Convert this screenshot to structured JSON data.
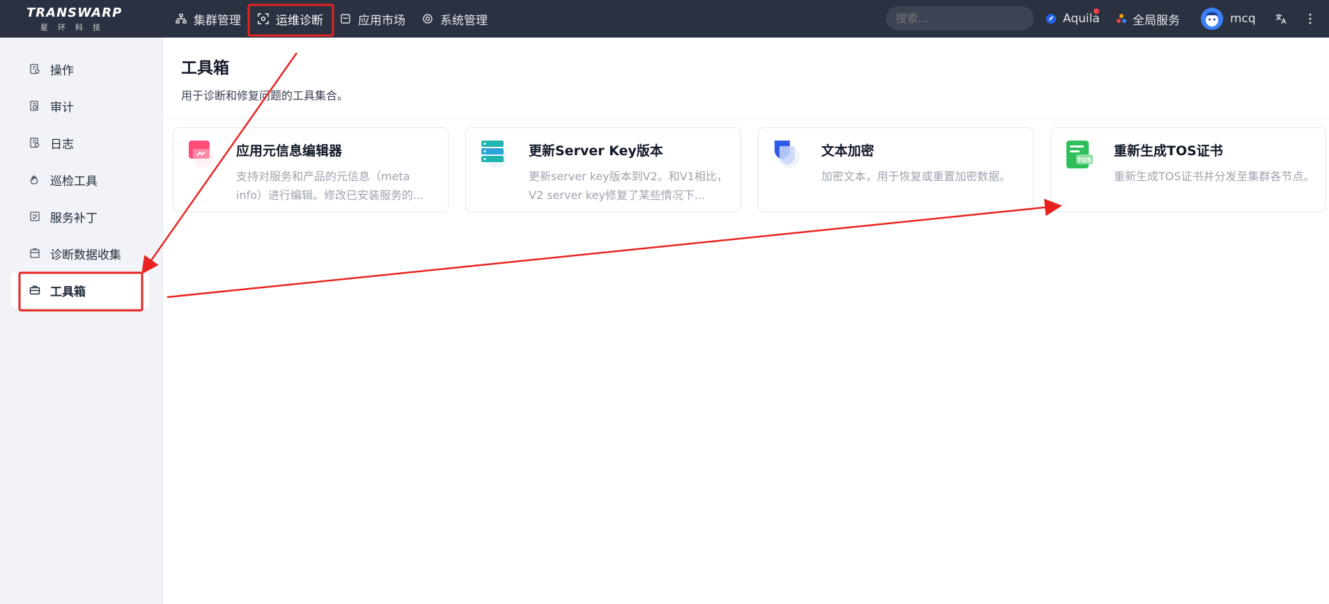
{
  "logo": {
    "main": "TRANSWARP",
    "sub": "星环科技"
  },
  "nav": [
    {
      "label": "集群管理",
      "icon": "cluster-icon"
    },
    {
      "label": "运维诊断",
      "icon": "scan-icon"
    },
    {
      "label": "应用市场",
      "icon": "store-icon"
    },
    {
      "label": "系统管理",
      "icon": "gear-icon"
    }
  ],
  "search": {
    "placeholder": "搜索..."
  },
  "top_right": {
    "aquila": "Aquila",
    "global_services": "全局服务",
    "user": "mcq"
  },
  "sidebar": {
    "items": [
      {
        "label": "操作",
        "icon": "operation-icon"
      },
      {
        "label": "审计",
        "icon": "audit-icon"
      },
      {
        "label": "日志",
        "icon": "log-icon"
      },
      {
        "label": "巡检工具",
        "icon": "patrol-icon"
      },
      {
        "label": "服务补丁",
        "icon": "patch-icon"
      },
      {
        "label": "诊断数据收集",
        "icon": "collect-icon"
      },
      {
        "label": "工具箱",
        "icon": "toolbox-icon"
      }
    ]
  },
  "main": {
    "title": "工具箱",
    "description": "用于诊断和修复问题的工具集合。",
    "cards": [
      {
        "title": "应用元信息编辑器",
        "description": "支持对服务和产品的元信息（meta info）进行编辑。修改已安装服务的...",
        "icon": "meta-editor-icon"
      },
      {
        "title": "更新Server Key版本",
        "description": "更新server key版本到V2。和V1相比，V2 server key修复了某些情况下...",
        "icon": "server-key-icon"
      },
      {
        "title": "文本加密",
        "description": "加密文本，用于恢复或重置加密数据。",
        "icon": "encrypt-icon"
      },
      {
        "title": "重新生成TOS证书",
        "description": "重新生成TOS证书并分发至集群各节点。",
        "icon": "tos-cert-icon"
      }
    ]
  },
  "colors": {
    "topbar": "#2a3140",
    "annotation": "#e8231f",
    "sidebar_bg": "#f1f3f8"
  }
}
